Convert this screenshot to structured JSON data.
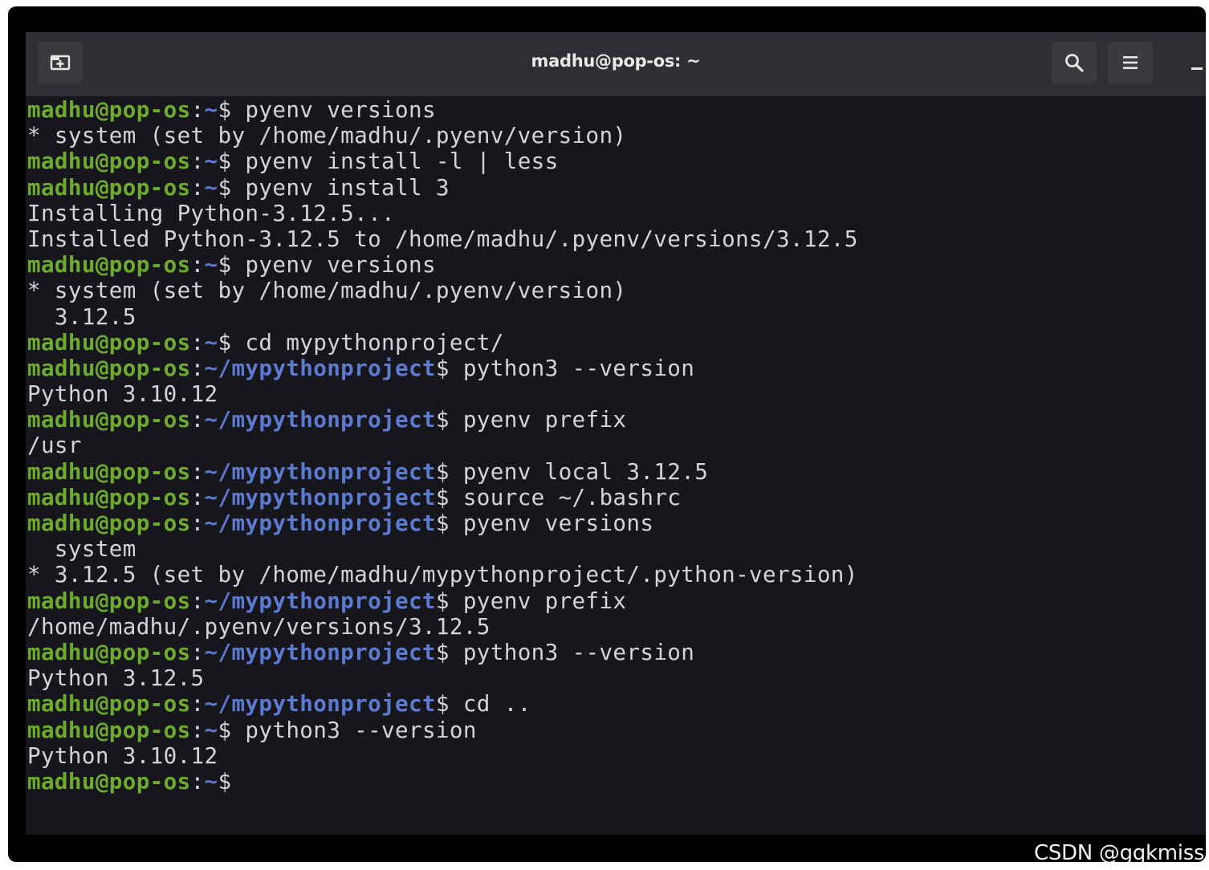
{
  "window": {
    "title": "madhu@pop-os: ~"
  },
  "titlebar": {
    "new_tab_icon": "new-tab-icon",
    "search_icon": "search-icon",
    "menu_icon": "hamburger-menu-icon",
    "minimize_icon": "minimize-icon"
  },
  "terminal": {
    "lines": [
      {
        "user": "madhu@pop-os",
        "sep": ":",
        "path": "~",
        "sym": "$",
        "cmd": " pyenv versions"
      },
      {
        "text": "* system (set by /home/madhu/.pyenv/version)"
      },
      {
        "user": "madhu@pop-os",
        "sep": ":",
        "path": "~",
        "sym": "$",
        "cmd": " pyenv install -l | less"
      },
      {
        "user": "madhu@pop-os",
        "sep": ":",
        "path": "~",
        "sym": "$",
        "cmd": " pyenv install 3"
      },
      {
        "text": "Installing Python-3.12.5..."
      },
      {
        "text": "Installed Python-3.12.5 to /home/madhu/.pyenv/versions/3.12.5"
      },
      {
        "user": "madhu@pop-os",
        "sep": ":",
        "path": "~",
        "sym": "$",
        "cmd": " pyenv versions"
      },
      {
        "text": "* system (set by /home/madhu/.pyenv/version)"
      },
      {
        "text": "  3.12.5"
      },
      {
        "user": "madhu@pop-os",
        "sep": ":",
        "path": "~",
        "sym": "$",
        "cmd": " cd mypythonproject/"
      },
      {
        "user": "madhu@pop-os",
        "sep": ":",
        "path": "~/mypythonproject",
        "sym": "$",
        "cmd": " python3 --version"
      },
      {
        "text": "Python 3.10.12"
      },
      {
        "user": "madhu@pop-os",
        "sep": ":",
        "path": "~/mypythonproject",
        "sym": "$",
        "cmd": " pyenv prefix"
      },
      {
        "text": "/usr"
      },
      {
        "user": "madhu@pop-os",
        "sep": ":",
        "path": "~/mypythonproject",
        "sym": "$",
        "cmd": " pyenv local 3.12.5"
      },
      {
        "user": "madhu@pop-os",
        "sep": ":",
        "path": "~/mypythonproject",
        "sym": "$",
        "cmd": " source ~/.bashrc"
      },
      {
        "user": "madhu@pop-os",
        "sep": ":",
        "path": "~/mypythonproject",
        "sym": "$",
        "cmd": " pyenv versions"
      },
      {
        "text": "  system"
      },
      {
        "text": "* 3.12.5 (set by /home/madhu/mypythonproject/.python-version)"
      },
      {
        "user": "madhu@pop-os",
        "sep": ":",
        "path": "~/mypythonproject",
        "sym": "$",
        "cmd": " pyenv prefix"
      },
      {
        "text": "/home/madhu/.pyenv/versions/3.12.5"
      },
      {
        "user": "madhu@pop-os",
        "sep": ":",
        "path": "~/mypythonproject",
        "sym": "$",
        "cmd": " python3 --version"
      },
      {
        "text": "Python 3.12.5"
      },
      {
        "user": "madhu@pop-os",
        "sep": ":",
        "path": "~/mypythonproject",
        "sym": "$",
        "cmd": " cd .."
      },
      {
        "user": "madhu@pop-os",
        "sep": ":",
        "path": "~",
        "sym": "$",
        "cmd": " python3 --version"
      },
      {
        "text": "Python 3.10.12"
      },
      {
        "user": "madhu@pop-os",
        "sep": ":",
        "path": "~",
        "sym": "$",
        "cmd": ""
      }
    ]
  },
  "watermark": "CSDN @gqkmiss",
  "colors": {
    "prompt_user": "#6dab2e",
    "prompt_path": "#5c7bd0",
    "terminal_bg": "#17161c",
    "titlebar_bg": "#2f2e33",
    "text": "#d4d4d4"
  }
}
